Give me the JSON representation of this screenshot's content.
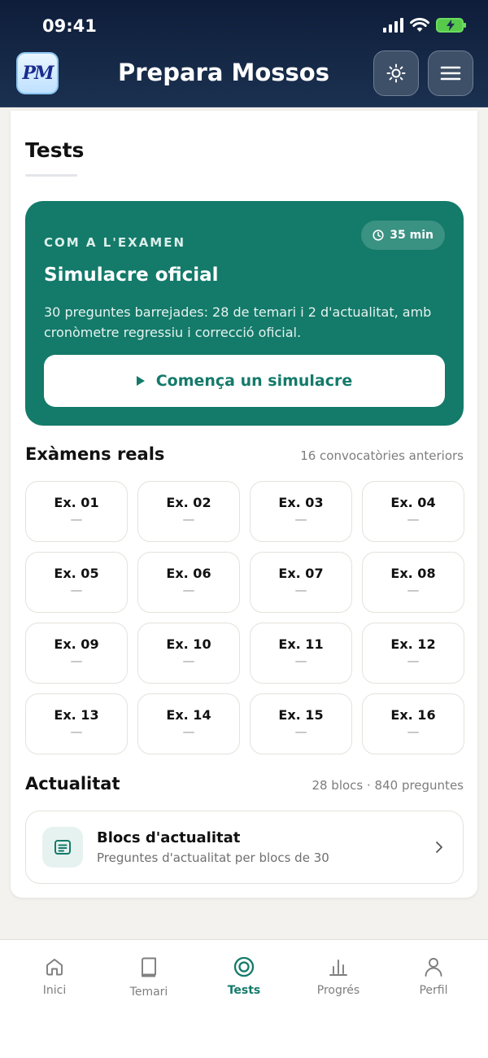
{
  "status_bar": {
    "time": "09:41"
  },
  "header": {
    "logo_text": "PM",
    "title": "Prepara Mossos",
    "theme_icon": "sun-icon",
    "menu_icon": "hamburger-menu-icon"
  },
  "page": {
    "title": "Tests"
  },
  "hero": {
    "kicker": "COM A L'EXAMEN",
    "duration": "35 min",
    "title": "Simulacre oficial",
    "description": "30 preguntes barrejades: 28 de temari i 2 d'actualitat, amb cronòmetre regressiu i correcció oficial.",
    "button_label": "Comença un simulacre",
    "accent_color": "#147a6a"
  },
  "exams": {
    "title": "Exàmens reals",
    "meta": "16 convocatòries anteriors",
    "items": [
      {
        "label": "Ex. 01",
        "score": "—"
      },
      {
        "label": "Ex. 02",
        "score": "—"
      },
      {
        "label": "Ex. 03",
        "score": "—"
      },
      {
        "label": "Ex. 04",
        "score": "—"
      },
      {
        "label": "Ex. 05",
        "score": "—"
      },
      {
        "label": "Ex. 06",
        "score": "—"
      },
      {
        "label": "Ex. 07",
        "score": "—"
      },
      {
        "label": "Ex. 08",
        "score": "—"
      },
      {
        "label": "Ex. 09",
        "score": "—"
      },
      {
        "label": "Ex. 10",
        "score": "—"
      },
      {
        "label": "Ex. 11",
        "score": "—"
      },
      {
        "label": "Ex. 12",
        "score": "—"
      },
      {
        "label": "Ex. 13",
        "score": "—"
      },
      {
        "label": "Ex. 14",
        "score": "—"
      },
      {
        "label": "Ex. 15",
        "score": "—"
      },
      {
        "label": "Ex. 16",
        "score": "—"
      }
    ]
  },
  "actualitat": {
    "title": "Actualitat",
    "meta": "28 blocs · 840 preguntes",
    "card_title": "Blocs d'actualitat",
    "card_subtitle": "Preguntes d'actualitat per blocs de 30"
  },
  "nav": {
    "items": [
      {
        "label": "Inici",
        "icon": "home-icon"
      },
      {
        "label": "Temari",
        "icon": "book-icon"
      },
      {
        "label": "Tests",
        "icon": "target-icon",
        "active": true
      },
      {
        "label": "Progrés",
        "icon": "bar-chart-icon"
      },
      {
        "label": "Perfil",
        "icon": "user-icon"
      }
    ]
  }
}
